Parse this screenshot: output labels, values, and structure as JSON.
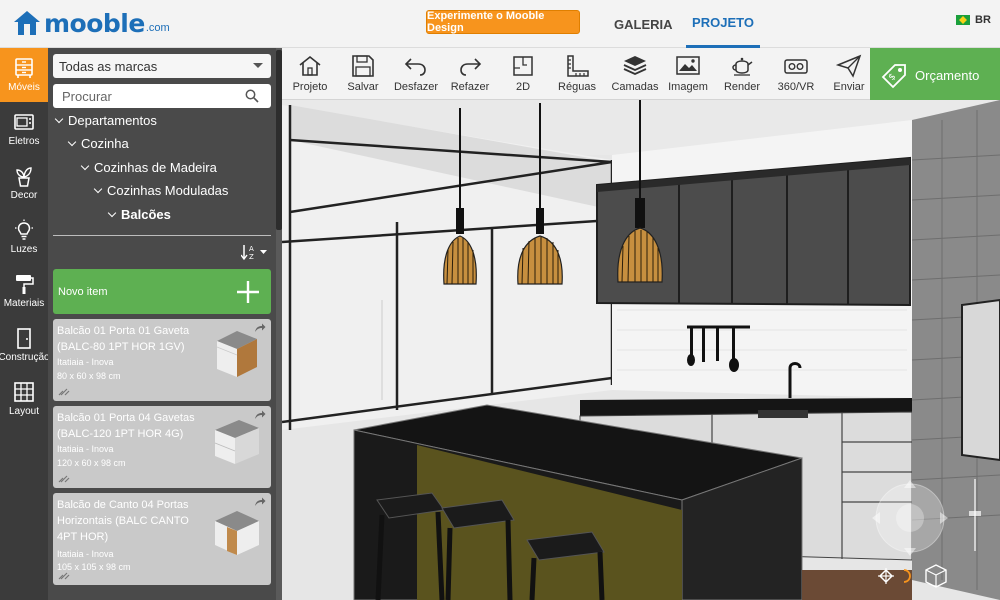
{
  "header": {
    "logo_text": "mooble",
    "logo_suffix": ".com",
    "cta_label": "Experimente o Mooble Design",
    "nav_gallery": "GALERIA",
    "nav_project": "PROJETO",
    "language": "BR"
  },
  "categories": [
    {
      "label": "Móveis",
      "icon": "furniture-icon",
      "active": true
    },
    {
      "label": "Eletros",
      "icon": "appliance-icon"
    },
    {
      "label": "Decor",
      "icon": "plant-icon"
    },
    {
      "label": "Luzes",
      "icon": "lightbulb-icon"
    },
    {
      "label": "Materiais",
      "icon": "paint-roller-icon"
    },
    {
      "label": "Construção",
      "icon": "door-icon"
    },
    {
      "label": "Layout",
      "icon": "layout-grid-icon"
    }
  ],
  "sidebar": {
    "brand_select": "Todas as marcas",
    "search_placeholder": "Procurar",
    "tree": [
      {
        "label": "Departamentos"
      },
      {
        "label": "Cozinha"
      },
      {
        "label": "Cozinhas de Madeira"
      },
      {
        "label": "Cozinhas Moduladas"
      },
      {
        "label": "Balcões"
      }
    ],
    "new_item_label": "Novo item",
    "products": [
      {
        "title": "Balcão 01 Porta 01 Gaveta (BALC-80 1PT HOR 1GV)",
        "brand": "Itatiaia - Inova",
        "size": "80 x 60 x 98 cm"
      },
      {
        "title": "Balcão 01 Porta 04 Gavetas (BALC-120 1PT HOR 4G)",
        "brand": "Itatiaia - Inova",
        "size": "120 x 60 x 98 cm"
      },
      {
        "title": "Balcão de Canto 04 Portas Horizontais (BALC CANTO 4PT HOR)",
        "brand": "Itatiaia - Inova",
        "size": "105 x 105 x 98 cm"
      }
    ]
  },
  "toolbar": {
    "items": [
      {
        "label": "Projeto",
        "icon": "home-icon"
      },
      {
        "label": "Salvar",
        "icon": "save-icon"
      },
      {
        "label": "Desfazer",
        "icon": "undo-icon"
      },
      {
        "label": "Refazer",
        "icon": "redo-icon"
      },
      {
        "label": "2D",
        "icon": "floorplan-icon"
      },
      {
        "label": "Réguas",
        "icon": "ruler-icon"
      },
      {
        "label": "Camadas",
        "icon": "layers-icon"
      },
      {
        "label": "Imagem",
        "icon": "image-icon"
      },
      {
        "label": "Render",
        "icon": "teapot-icon"
      },
      {
        "label": "360/VR",
        "icon": "vr-headset-icon"
      },
      {
        "label": "Enviar",
        "icon": "send-icon"
      }
    ],
    "quote_label": "Orçamento"
  },
  "colors": {
    "accent_orange": "#f7941d",
    "brand_blue": "#1d6fb8",
    "green": "#5eb052",
    "sidebar_dark": "#3b3b3b",
    "panel": "#4a4a4a"
  }
}
